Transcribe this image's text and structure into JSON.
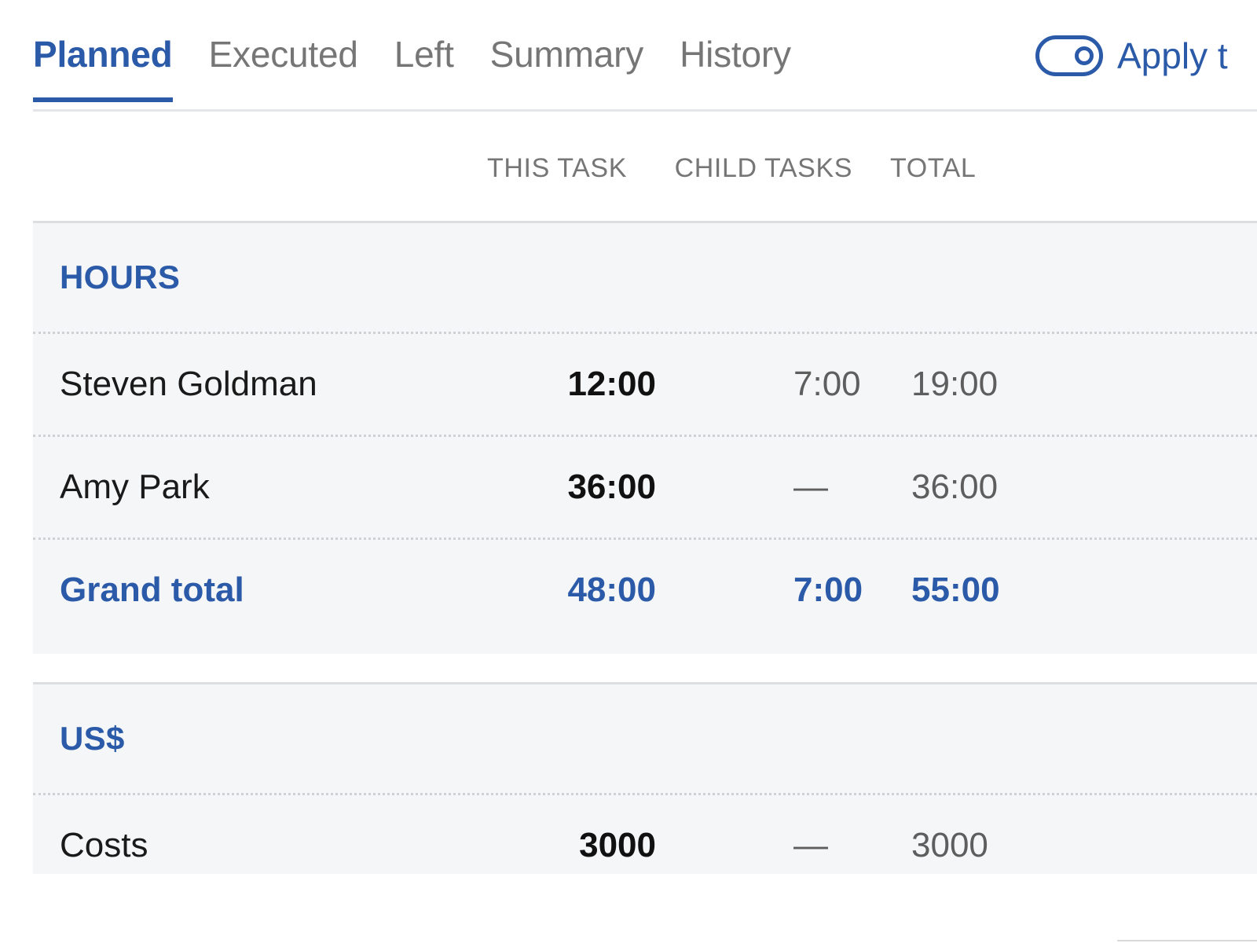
{
  "tabs": [
    {
      "label": "Planned",
      "active": true
    },
    {
      "label": "Executed",
      "active": false
    },
    {
      "label": "Left",
      "active": false
    },
    {
      "label": "Summary",
      "active": false
    },
    {
      "label": "History",
      "active": false
    }
  ],
  "apply_toggle": {
    "label": "Apply t",
    "state": "on",
    "icon": "toggle-switch-icon"
  },
  "columns": {
    "label": "",
    "this_task": "THIS TASK",
    "child_tasks": "CHILD TASKS",
    "total": "TOTAL"
  },
  "sections": [
    {
      "title": "HOURS",
      "rows": [
        {
          "label": "Steven Goldman",
          "this_task": "12:00",
          "child_tasks": "7:00",
          "total": "19:00",
          "grand": false
        },
        {
          "label": "Amy Park",
          "this_task": "36:00",
          "child_tasks": "—",
          "total": "36:00",
          "grand": false
        },
        {
          "label": "Grand total",
          "this_task": "48:00",
          "child_tasks": "7:00",
          "total": "55:00",
          "grand": true
        }
      ]
    },
    {
      "title": "US$",
      "rows": [
        {
          "label": "Costs",
          "this_task": "3000",
          "child_tasks": "—",
          "total": "3000",
          "grand": false
        }
      ]
    }
  ],
  "colors": {
    "accent_blue": "#2b5aa8",
    "inactive_gray": "#767676",
    "panel_bg": "#f5f6f7",
    "value_dark": "#111111",
    "value_gray": "#5e5e5e"
  }
}
